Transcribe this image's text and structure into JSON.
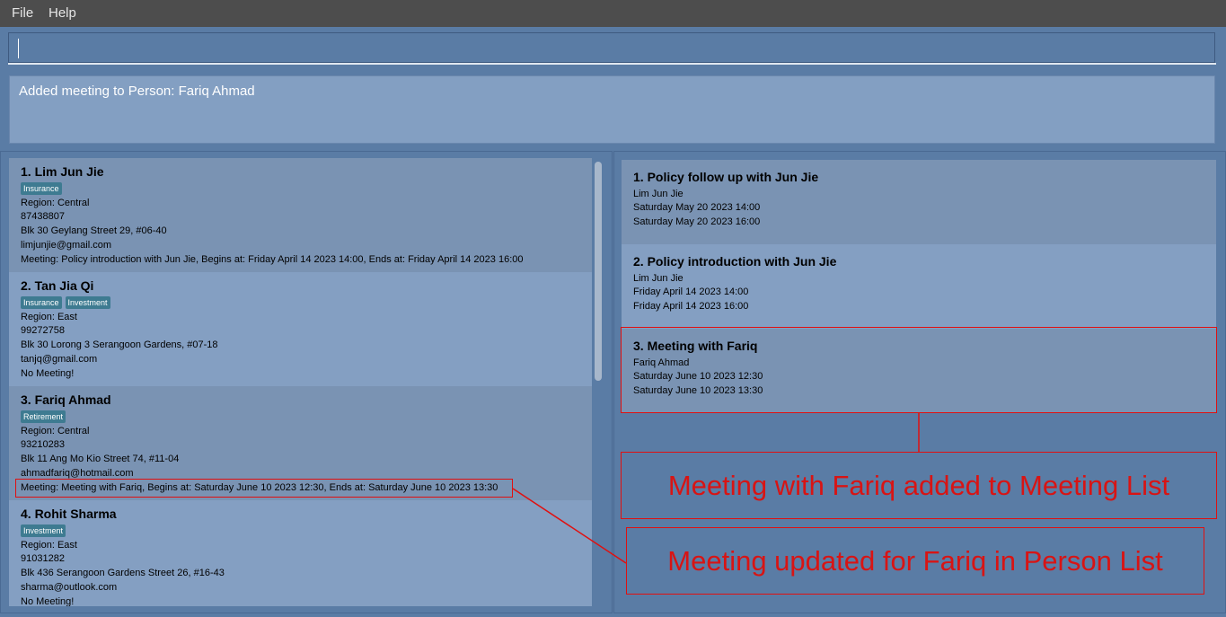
{
  "menu": {
    "file": "File",
    "help": "Help"
  },
  "command": {
    "value": ""
  },
  "result": {
    "text": "Added meeting to Person: Fariq Ahmad"
  },
  "persons": [
    {
      "name": "1.  Lim Jun Jie",
      "tags": [
        "Insurance"
      ],
      "region": "Region: Central",
      "phone": "87438807",
      "address": "Blk 30 Geylang Street 29, #06-40",
      "email": "limjunjie@gmail.com",
      "meeting": "Meeting: Policy introduction with Jun Jie, Begins at: Friday April 14 2023 14:00, Ends at: Friday April 14 2023 16:00"
    },
    {
      "name": "2.  Tan Jia Qi",
      "tags": [
        "Insurance",
        "Investment"
      ],
      "region": "Region: East",
      "phone": "99272758",
      "address": "Blk 30 Lorong 3 Serangoon Gardens, #07-18",
      "email": "tanjq@gmail.com",
      "meeting": "No Meeting!"
    },
    {
      "name": "3.  Fariq Ahmad",
      "tags": [
        "Retirement"
      ],
      "region": "Region: Central",
      "phone": "93210283",
      "address": "Blk 11 Ang Mo Kio Street 74, #11-04",
      "email": "ahmadfariq@hotmail.com",
      "meeting": "Meeting: Meeting with Fariq, Begins at: Saturday June 10 2023 12:30, Ends at: Saturday June 10 2023 13:30"
    },
    {
      "name": "4.  Rohit Sharma",
      "tags": [
        "Investment"
      ],
      "region": "Region: East",
      "phone": "91031282",
      "address": "Blk 436 Serangoon Gardens Street 26, #16-43",
      "email": "sharma@outlook.com",
      "meeting": "No Meeting!"
    }
  ],
  "meetings": [
    {
      "title": "1.  Policy follow up with Jun Jie",
      "person": "Lim Jun Jie",
      "start": "Saturday May 20 2023 14:00",
      "end": "Saturday May 20 2023 16:00"
    },
    {
      "title": "2.  Policy introduction with Jun Jie",
      "person": "Lim Jun Jie",
      "start": "Friday April 14 2023 14:00",
      "end": "Friday April 14 2023 16:00"
    },
    {
      "title": "3.  Meeting with Fariq",
      "person": "Fariq Ahmad",
      "start": "Saturday June 10 2023 12:30",
      "end": "Saturday June 10 2023 13:30"
    }
  ],
  "annotations": {
    "meeting_list_label": "Meeting with Fariq added to Meeting List",
    "person_list_label": "Meeting updated for Fariq in Person List",
    "color": "#e01010"
  },
  "colors": {
    "background": "#5a7ca5",
    "menubar": "#4d4d4d",
    "card_dark": "#7a93b3",
    "card_light": "#849fc2",
    "tag": "#3e7b91"
  }
}
